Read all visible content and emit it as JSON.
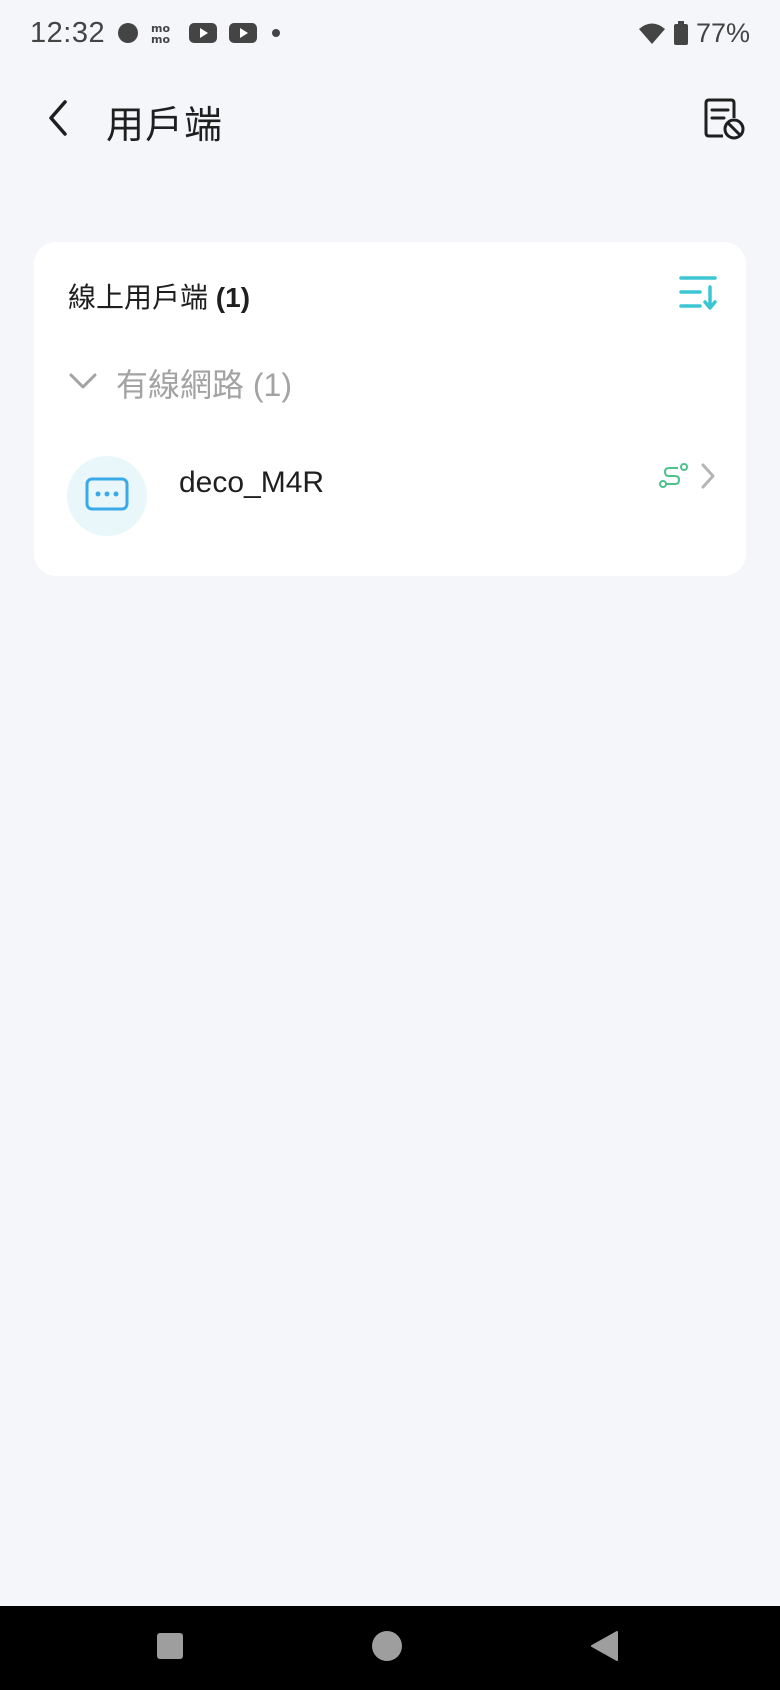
{
  "status_bar": {
    "time": "12:32",
    "battery": "77%",
    "icons": [
      "record-dot-icon",
      "mo-app-icon",
      "youtube-icon",
      "youtube-icon",
      "dot-icon",
      "wifi-icon",
      "battery-icon"
    ]
  },
  "app_bar": {
    "title": "用戶端",
    "back_icon": "chevron-left-icon",
    "action_icon": "blocklist-icon"
  },
  "online_clients": {
    "title": "線上用戶端",
    "count": "(1)",
    "sort_icon": "sort-icon",
    "accent": "#3cc6d4",
    "groups": [
      {
        "label": "有線網路 (1)",
        "expanded": true,
        "clients": [
          {
            "name": "deco_M4R",
            "icon": "network-device-icon",
            "connection_icon": "connection-path-icon"
          }
        ]
      }
    ]
  },
  "nav_bar": {
    "buttons": [
      "recents-icon",
      "home-icon",
      "back-triangle-icon"
    ]
  }
}
